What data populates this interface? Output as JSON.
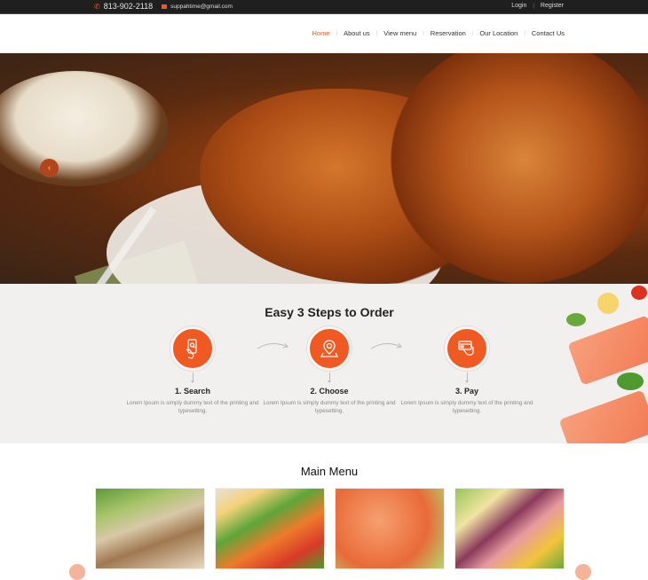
{
  "topbar": {
    "phone_icon": "phone-icon",
    "phone": "813-902-2118",
    "email_icon": "envelope-icon",
    "email": "suppahtime@gmail.com",
    "login": "Login",
    "register": "Register",
    "separator": "|"
  },
  "nav": {
    "items": [
      {
        "label": "Home",
        "active": true
      },
      {
        "label": "About us"
      },
      {
        "label": "View menu"
      },
      {
        "label": "Reservation"
      },
      {
        "label": "Our Location"
      },
      {
        "label": "Contact Us"
      }
    ],
    "separator": "|"
  },
  "hero": {
    "prev_icon": "‹",
    "image": "grilled-chicken-wings-photo"
  },
  "steps": {
    "title": "Easy 3 Steps to Order",
    "items": [
      {
        "title": "1. Search",
        "desc": "Lorem Ipsum is simply dummy text of the printing and typesetting.",
        "icon": "phone-search-icon"
      },
      {
        "title": "2. Choose",
        "desc": "Lorem Ipsum is simply dummy text of the printing and typesetting.",
        "icon": "location-pin-icon"
      },
      {
        "title": "3. Pay",
        "desc": "Lorem Ipsum is simply dummy text of the printing and typesetting.",
        "icon": "credit-card-hand-icon"
      }
    ]
  },
  "menu": {
    "title": "Main Menu",
    "cards": [
      {
        "image": "grilled-fish-salad"
      },
      {
        "image": "egg-carrot-salad"
      },
      {
        "image": "shrimp-lime"
      },
      {
        "image": "ham-cheese-salad"
      }
    ]
  },
  "colors": {
    "accent": "#f05a22",
    "topbar_bg": "#1f1f1f",
    "steps_bg": "#f1f0ee"
  }
}
